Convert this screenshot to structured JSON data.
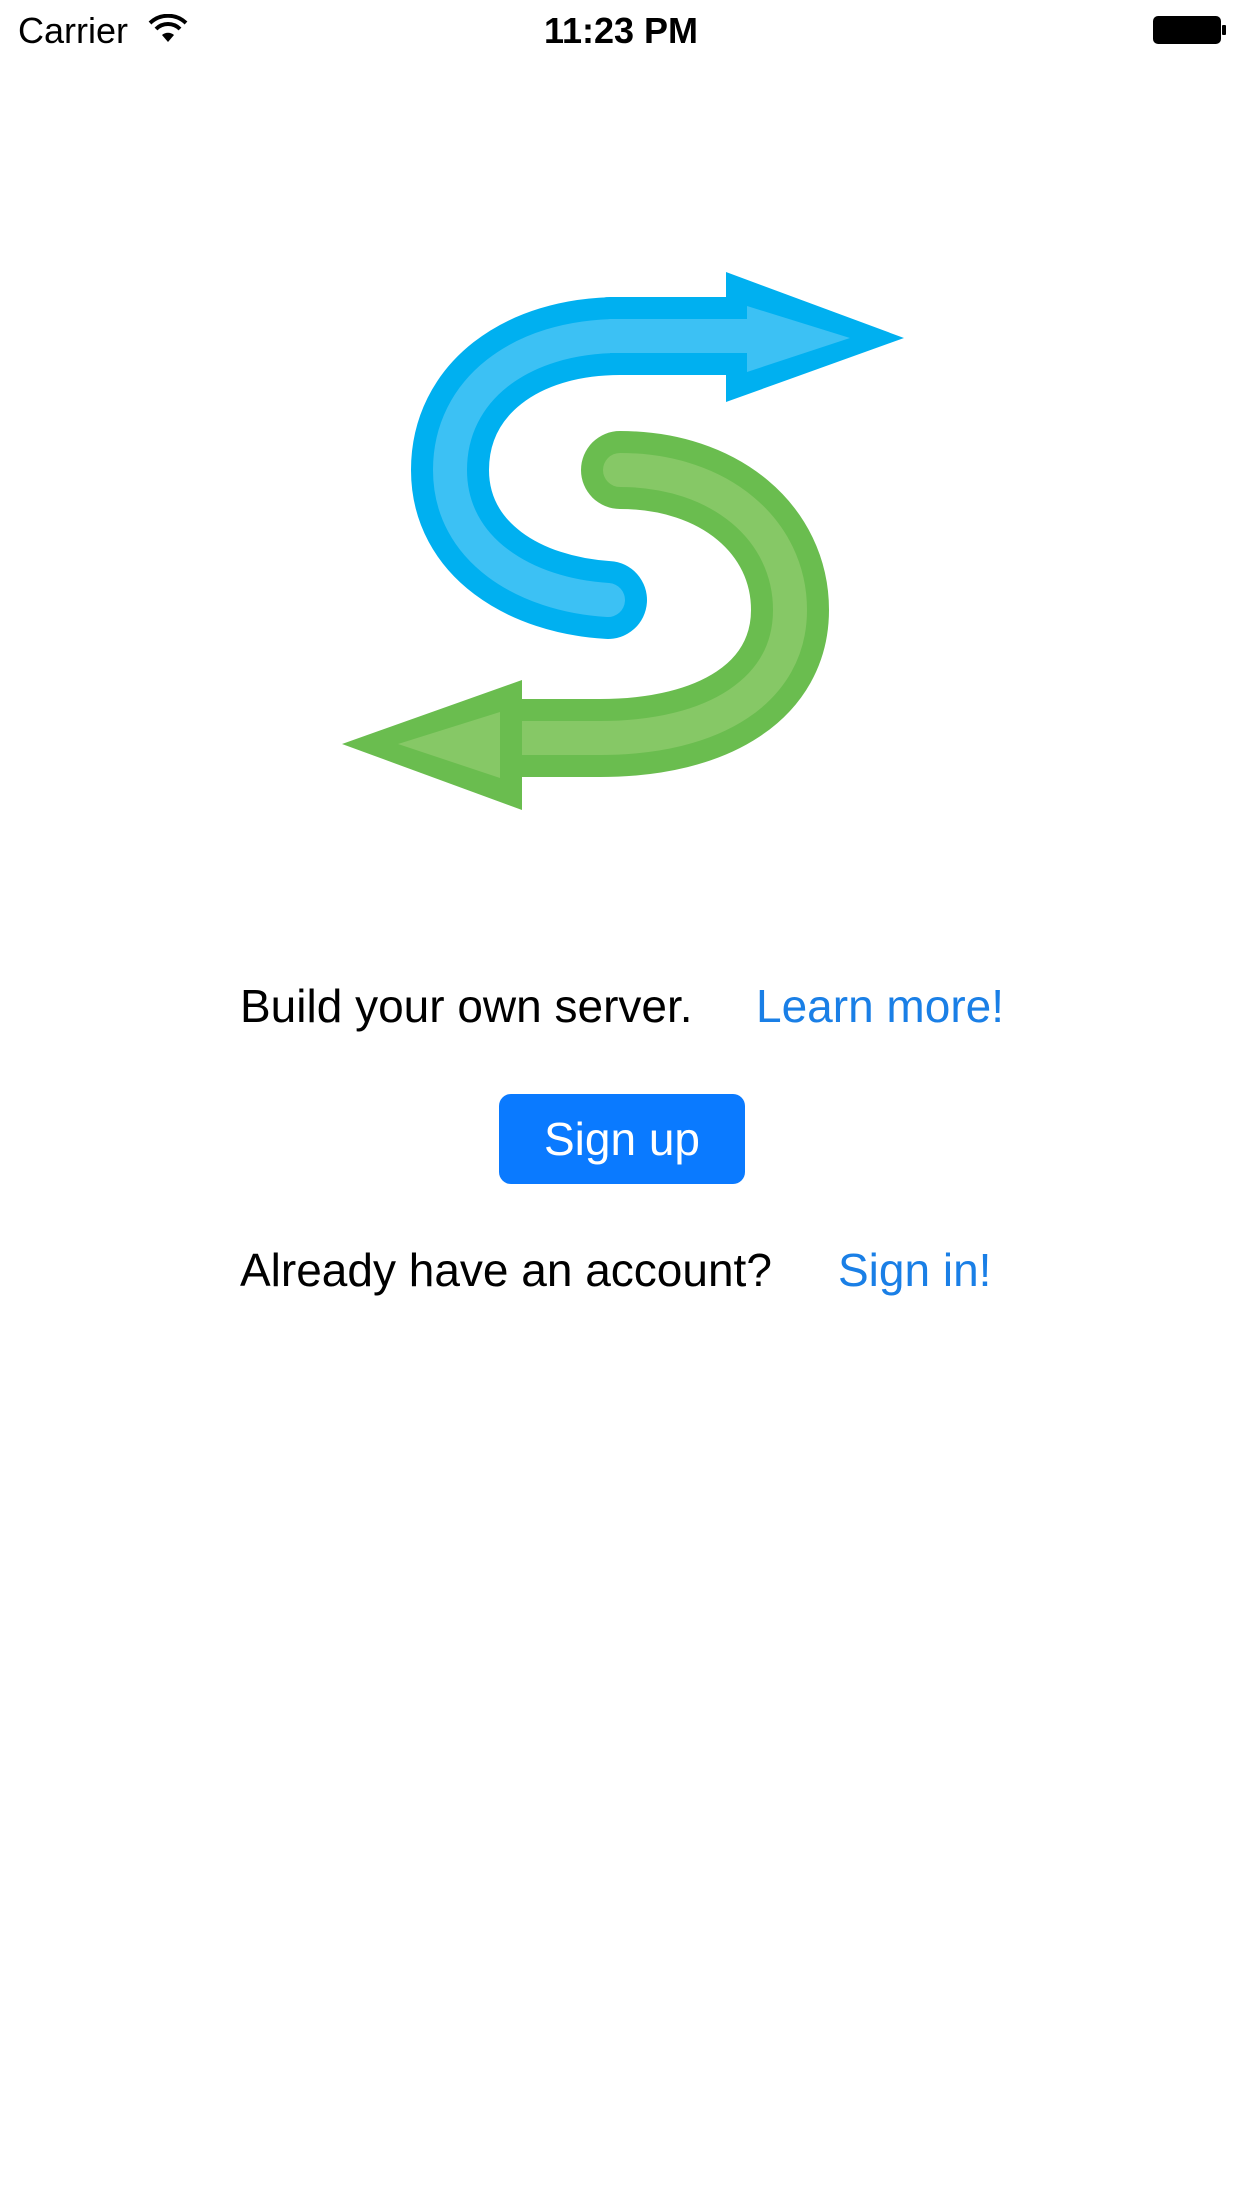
{
  "status_bar": {
    "carrier": "Carrier",
    "time": "11:23 PM"
  },
  "icons": {
    "wifi": "wifi-icon",
    "battery": "battery-icon",
    "logo": "app-logo-s-arrows"
  },
  "colors": {
    "blue_outer": "#00b0f0",
    "blue_inner": "#3cc1f4",
    "green_outer": "#6abd4f",
    "green_inner": "#86c866",
    "link": "#1a7fe6",
    "button": "#0a7aff"
  },
  "main": {
    "tagline": "Build your own server.",
    "learn_more": "Learn more!",
    "signup_button": "Sign up",
    "already_account": "Already have an account?",
    "sign_in": "Sign in!"
  }
}
